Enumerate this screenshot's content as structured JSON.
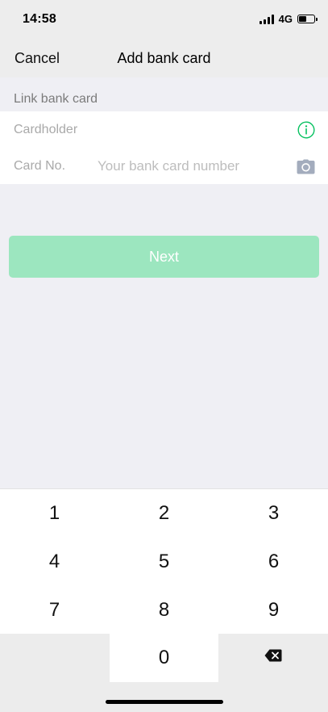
{
  "status_bar": {
    "time": "14:58",
    "network": "4G",
    "battery_level": 0.55
  },
  "nav": {
    "cancel_label": "Cancel",
    "title": "Add bank card"
  },
  "section": {
    "label": "Link bank card"
  },
  "form": {
    "cardholder_label": "Cardholder",
    "card_no_label": "Card No.",
    "card_no_placeholder": "Your bank card number",
    "card_no_value": ""
  },
  "next_button": {
    "label": "Next",
    "enabled": false,
    "color": "#9ce6bf"
  },
  "keypad": {
    "keys": [
      "1",
      "2",
      "3",
      "4",
      "5",
      "6",
      "7",
      "8",
      "9",
      "0"
    ]
  },
  "colors": {
    "accent": "#07c160",
    "background": "#efeff4"
  },
  "icons": {
    "info": "info-icon",
    "camera": "camera-icon",
    "backspace": "backspace-icon"
  }
}
